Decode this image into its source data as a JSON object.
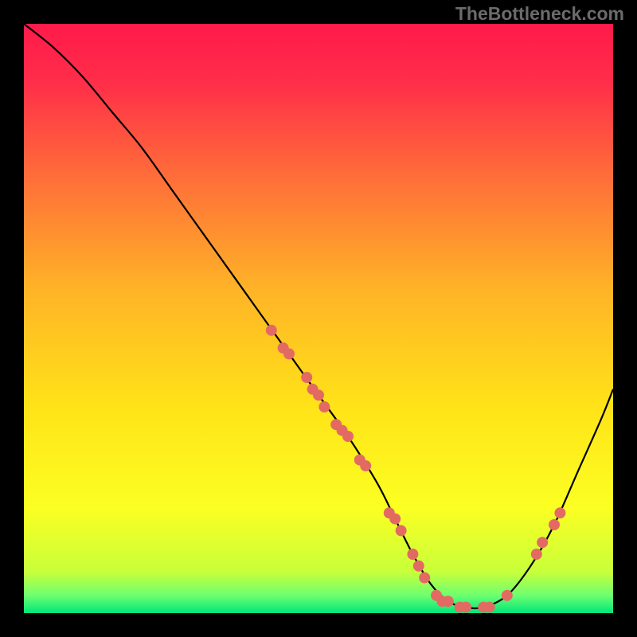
{
  "watermark": "TheBottleneck.com",
  "chart_data": {
    "type": "line",
    "title": "",
    "xlabel": "",
    "ylabel": "",
    "xlim": [
      0,
      100
    ],
    "ylim": [
      0,
      100
    ],
    "gradient_stops": [
      {
        "offset": 0.0,
        "color": "#ff1a4a"
      },
      {
        "offset": 0.1,
        "color": "#ff2e49"
      },
      {
        "offset": 0.25,
        "color": "#ff6a3a"
      },
      {
        "offset": 0.45,
        "color": "#ffb327"
      },
      {
        "offset": 0.65,
        "color": "#ffe318"
      },
      {
        "offset": 0.82,
        "color": "#fcff22"
      },
      {
        "offset": 0.93,
        "color": "#c8ff3a"
      },
      {
        "offset": 0.97,
        "color": "#6dff70"
      },
      {
        "offset": 1.0,
        "color": "#00e67a"
      }
    ],
    "series": [
      {
        "name": "bottleneck-curve",
        "color": "#000000",
        "x": [
          0,
          5,
          10,
          15,
          20,
          25,
          30,
          35,
          40,
          45,
          50,
          55,
          60,
          63,
          66,
          69,
          72,
          75,
          78,
          82,
          86,
          90,
          94,
          98,
          100
        ],
        "y": [
          100,
          96,
          91,
          85,
          79,
          72,
          65,
          58,
          51,
          44,
          37,
          30,
          22,
          16,
          10,
          5,
          2,
          1,
          1,
          3,
          8,
          15,
          24,
          33,
          38
        ]
      }
    ],
    "scatter_points": {
      "name": "highlighted-points",
      "color": "#e36a63",
      "radius": 7,
      "points": [
        {
          "x": 42,
          "y": 48
        },
        {
          "x": 44,
          "y": 45
        },
        {
          "x": 45,
          "y": 44
        },
        {
          "x": 48,
          "y": 40
        },
        {
          "x": 49,
          "y": 38
        },
        {
          "x": 50,
          "y": 37
        },
        {
          "x": 51,
          "y": 35
        },
        {
          "x": 53,
          "y": 32
        },
        {
          "x": 54,
          "y": 31
        },
        {
          "x": 55,
          "y": 30
        },
        {
          "x": 57,
          "y": 26
        },
        {
          "x": 58,
          "y": 25
        },
        {
          "x": 62,
          "y": 17
        },
        {
          "x": 63,
          "y": 16
        },
        {
          "x": 64,
          "y": 14
        },
        {
          "x": 66,
          "y": 10
        },
        {
          "x": 67,
          "y": 8
        },
        {
          "x": 68,
          "y": 6
        },
        {
          "x": 70,
          "y": 3
        },
        {
          "x": 71,
          "y": 2
        },
        {
          "x": 72,
          "y": 2
        },
        {
          "x": 74,
          "y": 1
        },
        {
          "x": 75,
          "y": 1
        },
        {
          "x": 78,
          "y": 1
        },
        {
          "x": 79,
          "y": 1
        },
        {
          "x": 82,
          "y": 3
        },
        {
          "x": 87,
          "y": 10
        },
        {
          "x": 88,
          "y": 12
        },
        {
          "x": 90,
          "y": 15
        },
        {
          "x": 91,
          "y": 17
        }
      ]
    }
  }
}
